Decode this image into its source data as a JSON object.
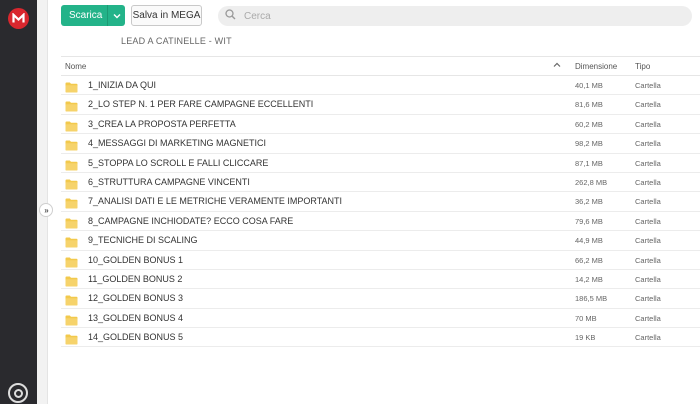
{
  "toolbar": {
    "download_label": "Scarica",
    "save_label": "Salva in MEGA"
  },
  "search": {
    "placeholder": "Cerca"
  },
  "folder_title": "LEAD A CATINELLE - WIT",
  "table": {
    "headers": {
      "name": "Nome",
      "size": "Dimensione",
      "type": "Tipo"
    },
    "rows": [
      {
        "name": "1_INIZIA DA QUI",
        "size": "40,1 MB",
        "type": "Cartella"
      },
      {
        "name": "2_LO STEP N. 1 PER FARE CAMPAGNE ECCELLENTI",
        "size": "81,6 MB",
        "type": "Cartella"
      },
      {
        "name": "3_CREA LA PROPOSTA PERFETTA",
        "size": "60,2 MB",
        "type": "Cartella"
      },
      {
        "name": "4_MESSAGGI DI MARKETING MAGNETICI",
        "size": "98,2 MB",
        "type": "Cartella"
      },
      {
        "name": "5_STOPPA LO SCROLL E FALLI CLICCARE",
        "size": "87,1 MB",
        "type": "Cartella"
      },
      {
        "name": "6_STRUTTURA CAMPAGNE VINCENTI",
        "size": "262,8 MB",
        "type": "Cartella"
      },
      {
        "name": "7_ANALISI DATI E LE METRICHE VERAMENTE IMPORTANTI",
        "size": "36,2 MB",
        "type": "Cartella"
      },
      {
        "name": "8_CAMPAGNE INCHIODATE? ECCO COSA FARE",
        "size": "79,6 MB",
        "type": "Cartella"
      },
      {
        "name": "9_TECNICHE DI SCALING",
        "size": "44,9 MB",
        "type": "Cartella"
      },
      {
        "name": "10_GOLDEN BONUS 1",
        "size": "66,2 MB",
        "type": "Cartella"
      },
      {
        "name": "11_GOLDEN BONUS 2",
        "size": "14,2 MB",
        "type": "Cartella"
      },
      {
        "name": "12_GOLDEN BONUS 3",
        "size": "186,5 MB",
        "type": "Cartella"
      },
      {
        "name": "13_GOLDEN BONUS 4",
        "size": "70 MB",
        "type": "Cartella"
      },
      {
        "name": "14_GOLDEN BONUS 5",
        "size": "19 KB",
        "type": "Cartella"
      }
    ]
  },
  "icons": {
    "logo": "mega-logo-icon",
    "folder": "folder-icon",
    "search": "search-icon",
    "caret": "chevron-down-icon",
    "sort": "sort-up-icon",
    "collapse": "expand-sidebar-icon",
    "bottom": "transfer-icon"
  },
  "colors": {
    "brand_red": "#d9272e",
    "accent_green": "#23b389",
    "folder_yellow": "#f2c94c",
    "rail_dark": "#2a2a2e"
  }
}
